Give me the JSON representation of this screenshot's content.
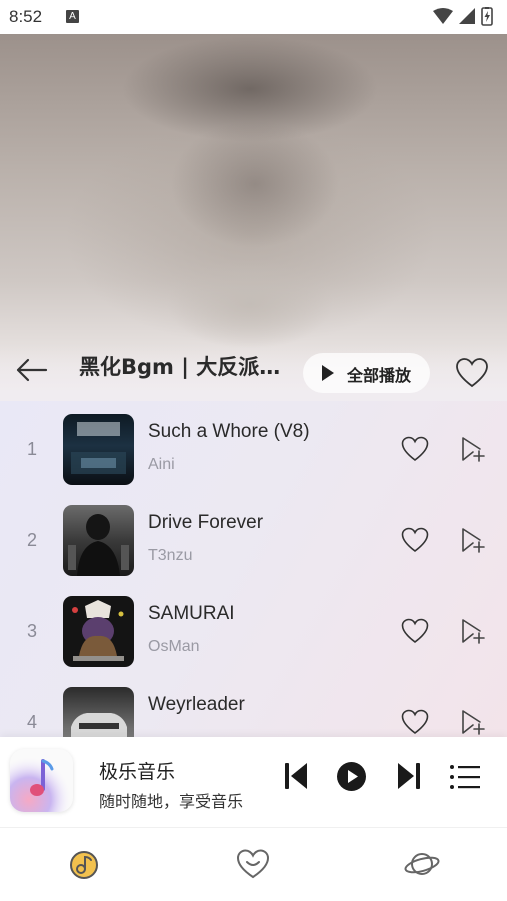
{
  "status_bar": {
    "time": "8:52",
    "badge": "A"
  },
  "header": {
    "title": "黑化Bgm | 大反派…",
    "play_all_label": "全部播放"
  },
  "songs": [
    {
      "index": "1",
      "title": "Such a Whore (V8)",
      "artist": "Aini"
    },
    {
      "index": "2",
      "title": "Drive Forever",
      "artist": "T3nzu"
    },
    {
      "index": "3",
      "title": "SAMURAI",
      "artist": "OsMan"
    },
    {
      "index": "4",
      "title": "Weyrleader",
      "artist": ""
    }
  ],
  "mini_player": {
    "title": "极乐音乐",
    "subtitle": "随时随地，享受音乐"
  },
  "colors": {
    "accent_yellow": "#f2c14e",
    "icon_gray": "#555555",
    "list_bg_start": "#e9e8f6",
    "list_bg_end": "#f3e4ea"
  },
  "icons": {
    "back": "arrow-left-icon",
    "play_all": "play-icon",
    "favorite": "heart-outline-icon",
    "add_to_playlist": "add-to-playlist-icon",
    "prev": "skip-previous-icon",
    "play": "play-circle-icon",
    "next": "skip-next-icon",
    "queue": "playlist-menu-icon",
    "nav_music": "music-disc-icon",
    "nav_favorites": "heart-chat-icon",
    "nav_discover": "planet-icon"
  }
}
